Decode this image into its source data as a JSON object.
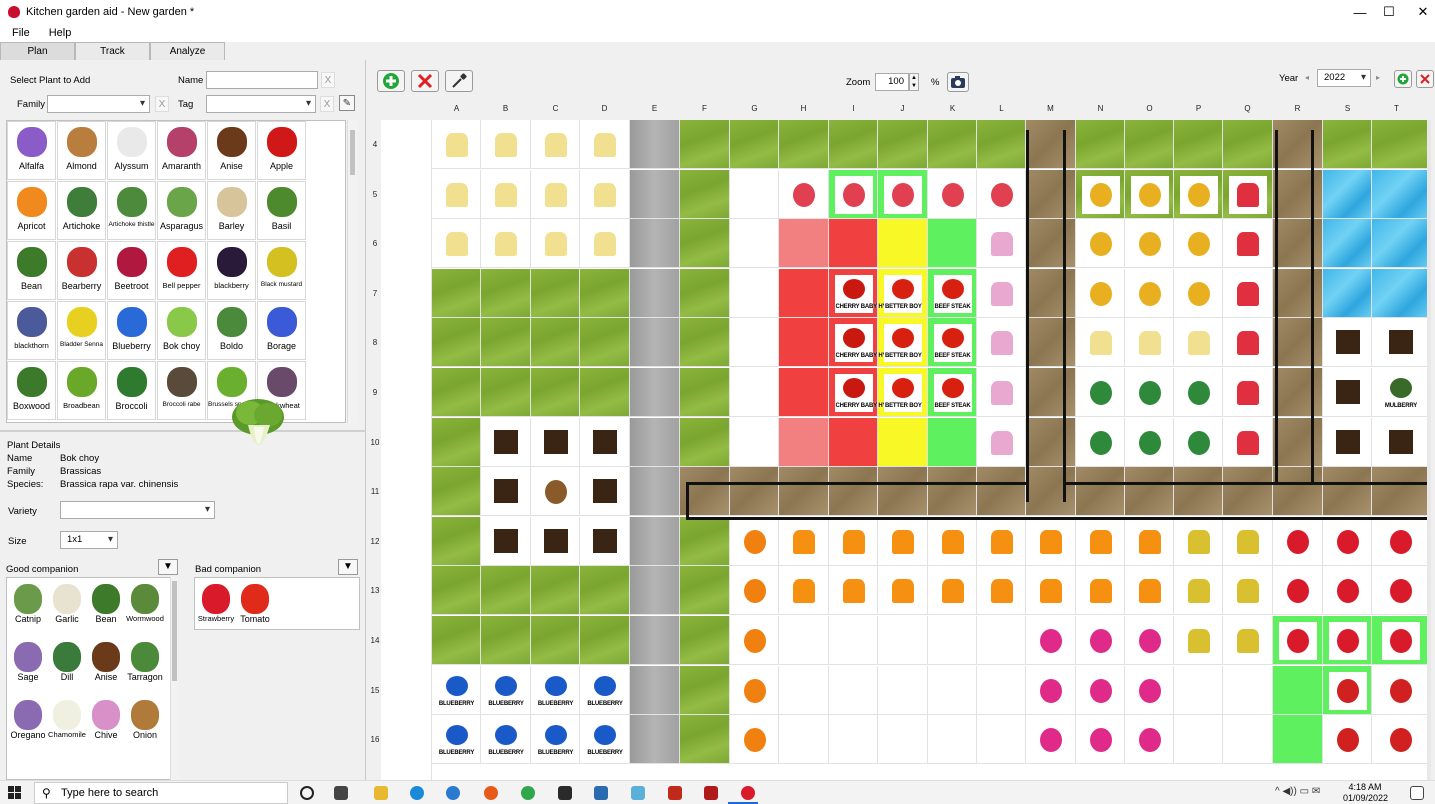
{
  "window": {
    "title": "Kitchen garden aid - New garden *",
    "min": "—",
    "max": "☐",
    "close": "✕"
  },
  "menu": [
    "File",
    "Help"
  ],
  "tabs": [
    "Plan",
    "Track",
    "Analyze"
  ],
  "left": {
    "select_heading": "Select Plant to Add",
    "name_label": "Name",
    "name_value": "",
    "name_clear": "X",
    "family_label": "Family",
    "family_value": "",
    "family_clear": "X",
    "tag_label": "Tag",
    "tag_value": "",
    "tag_clear": "X",
    "plants": [
      {
        "name": "Alfalfa",
        "icon": "alfalfa-icon",
        "color": "#8b5cc7"
      },
      {
        "name": "Almond",
        "icon": "almond-icon",
        "color": "#b97e3e"
      },
      {
        "name": "Alyssum",
        "icon": "alyssum-icon",
        "color": "#e9e9e9"
      },
      {
        "name": "Amaranth",
        "icon": "amaranth-icon",
        "color": "#b5406a"
      },
      {
        "name": "Anise",
        "icon": "anise-icon",
        "color": "#6a3a1a"
      },
      {
        "name": "Apple",
        "icon": "apple-icon",
        "color": "#d01818"
      },
      {
        "name": "Apricot",
        "icon": "apricot-icon",
        "color": "#f08a1e"
      },
      {
        "name": "Artichoke",
        "icon": "artichoke-icon",
        "color": "#3f7d3a"
      },
      {
        "name": "Artichoke thistle",
        "icon": "artichoke-thistle-icon",
        "color": "#4e8a3c",
        "small": true
      },
      {
        "name": "Asparagus",
        "icon": "asparagus-icon",
        "color": "#6aa54a"
      },
      {
        "name": "Barley",
        "icon": "barley-icon",
        "color": "#d8c49a"
      },
      {
        "name": "Basil",
        "icon": "basil-icon",
        "color": "#4d8a2e"
      },
      {
        "name": "Bean",
        "icon": "bean-icon",
        "color": "#3d7a2a"
      },
      {
        "name": "Bearberry",
        "icon": "bearberry-icon",
        "color": "#c93030"
      },
      {
        "name": "Beetroot",
        "icon": "beetroot-icon",
        "color": "#b01840"
      },
      {
        "name": "Bell pepper",
        "icon": "bell-pepper-icon",
        "color": "#e02020",
        "small2": true
      },
      {
        "name": "blackberry",
        "icon": "blackberry-icon",
        "color": "#2a1a3a",
        "small2": true
      },
      {
        "name": "Black mustard",
        "icon": "black-mustard-icon",
        "color": "#d4c020",
        "small": true
      },
      {
        "name": "blackthorn",
        "icon": "blackthorn-icon",
        "color": "#4a5a9a",
        "small2": true
      },
      {
        "name": "Bladder Senna",
        "icon": "bladder-senna-icon",
        "color": "#e8d020",
        "small": true
      },
      {
        "name": "Blueberry",
        "icon": "blueberry-icon",
        "color": "#2a6ad8"
      },
      {
        "name": "Bok choy",
        "icon": "bok-choy-icon",
        "color": "#8ac84a"
      },
      {
        "name": "Boldo",
        "icon": "boldo-icon",
        "color": "#4a8a3a"
      },
      {
        "name": "Borage",
        "icon": "borage-icon",
        "color": "#3a5ad8"
      },
      {
        "name": "Boxwood",
        "icon": "boxwood-icon",
        "color": "#3a7a2a"
      },
      {
        "name": "Broadbean",
        "icon": "broadbean-icon",
        "color": "#6aa82a",
        "small2": true
      },
      {
        "name": "Broccoli",
        "icon": "broccoli-icon",
        "color": "#2e7a2e"
      },
      {
        "name": "Broccoli rabe",
        "icon": "broccoli-rabe-icon",
        "color": "#5a4a3a",
        "small": true
      },
      {
        "name": "Brussels sprouts",
        "icon": "brussels-sprouts-icon",
        "color": "#6ab02e",
        "small": true
      },
      {
        "name": "Buckwheat",
        "icon": "buckwheat-icon",
        "color": "#6a4a6a",
        "small2": true
      }
    ],
    "details": {
      "heading": "Plant Details",
      "name_label": "Name",
      "name": "Bok choy",
      "family_label": "Family",
      "family": "Brassicas",
      "species_label": "Species:",
      "species": "Brassica rapa var. chinensis",
      "variety_label": "Variety",
      "variety": "",
      "size_label": "Size",
      "size": "1x1"
    },
    "good_label": "Good companion",
    "bad_label": "Bad companion",
    "good": [
      {
        "name": "Catnip",
        "icon": "catnip-icon",
        "color": "#6a9a4a"
      },
      {
        "name": "Garlic",
        "icon": "garlic-icon",
        "color": "#e8e2d0"
      },
      {
        "name": "Bean",
        "icon": "bean-icon",
        "color": "#3d7a2a"
      },
      {
        "name": "Wormwood",
        "icon": "wormwood-icon",
        "color": "#5a8a3a",
        "small": true
      },
      {
        "name": "Sage",
        "icon": "sage-icon",
        "color": "#8a6ab0"
      },
      {
        "name": "Dill",
        "icon": "dill-icon",
        "color": "#3a7a3a"
      },
      {
        "name": "Anise",
        "icon": "anise-icon",
        "color": "#6a3a1a"
      },
      {
        "name": "Tarragon",
        "icon": "tarragon-icon",
        "color": "#4a8a3a"
      },
      {
        "name": "Oregano",
        "icon": "oregano-icon",
        "color": "#8a6ab0"
      },
      {
        "name": "Chamomile",
        "icon": "chamomile-icon",
        "color": "#f0f0e0",
        "small": true
      },
      {
        "name": "Chive",
        "icon": "chive-icon",
        "color": "#d890c8"
      },
      {
        "name": "Onion",
        "icon": "onion-icon",
        "color": "#b07a3a"
      }
    ],
    "bad": [
      {
        "name": "Strawberry",
        "icon": "strawberry-icon",
        "color": "#d81a2a",
        "small": true
      },
      {
        "name": "Tomato",
        "icon": "tomato-icon",
        "color": "#e02a1a"
      }
    ]
  },
  "toolbar": {
    "add_icon": "add-icon",
    "delete_icon": "delete-icon",
    "picker_icon": "eyedropper-icon",
    "zoom_label": "Zoom",
    "zoom_value": "100",
    "zoom_unit": "%",
    "camera_icon": "camera-icon",
    "year_label": "Year",
    "year_value": "2022"
  },
  "grid": {
    "columns": [
      "A",
      "B",
      "C",
      "D",
      "E",
      "F",
      "G",
      "H",
      "I",
      "J",
      "K",
      "L",
      "M",
      "N",
      "O",
      "P",
      "Q",
      "R",
      "S",
      "T"
    ],
    "rows": [
      "4",
      "5",
      "6",
      "7",
      "8",
      "9",
      "10",
      "11",
      "12",
      "13",
      "14",
      "15",
      "16"
    ],
    "labels": {
      "cherry": "CHERRY BABY HYBRID",
      "better": "BETTER BOY",
      "beef": "BEEF STEAK",
      "blueberry": "BLUEBERRY",
      "mulberry": "MULBERRY"
    },
    "colors": {
      "radish": "#e04050",
      "alyssum": "#f0e090",
      "sunflower": "#e8b020",
      "tulip": "#e03040",
      "watermelon": "#2e8a3a",
      "marigold": "#f08010",
      "calendula": "#f59010",
      "mustard": "#d8c030",
      "strawberry": "#d81a2a",
      "petunia": "#e02a8a",
      "tomato": "#d82010",
      "cherry": "#c81810",
      "blueberry": "#1a5ac8",
      "chive": "#e8a8d0",
      "rhubarb": "#d02020",
      "walnut": "#8a5a2a",
      "mulberry": "#3a6a2a"
    }
  },
  "taskbar": {
    "search_placeholder": "Type here to search",
    "time": "4:18 AM",
    "date": "01/09/2022"
  }
}
